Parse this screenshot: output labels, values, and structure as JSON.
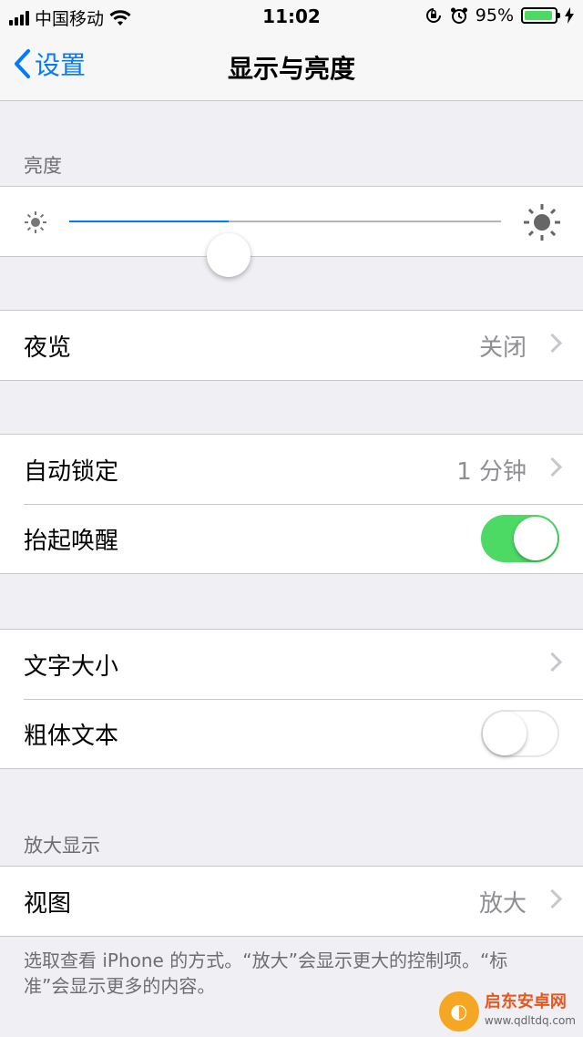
{
  "status_bar": {
    "carrier": "中国移动",
    "time": "11:02",
    "battery_percent": "95%",
    "battery_level": 0.95
  },
  "nav": {
    "back_label": "设置",
    "title": "显示与亮度"
  },
  "brightness": {
    "header": "亮度",
    "level": 0.37
  },
  "night_shift": {
    "label": "夜览",
    "value": "关闭"
  },
  "lock_group": {
    "auto_lock_label": "自动锁定",
    "auto_lock_value": "1 分钟",
    "raise_to_wake_label": "抬起唤醒",
    "raise_to_wake_on": true
  },
  "text_group": {
    "text_size_label": "文字大小",
    "bold_text_label": "粗体文本",
    "bold_text_on": false
  },
  "zoom": {
    "header": "放大显示",
    "view_label": "视图",
    "view_value": "放大",
    "footer": "选取查看 iPhone 的方式。“放大”会显示更大的控制项。“标准”会显示更多的内容。"
  },
  "watermark": {
    "name": "启东安卓网",
    "url": "www.qdltdq.com"
  },
  "colors": {
    "accent": "#007aff",
    "toggle_on": "#4cd964"
  }
}
